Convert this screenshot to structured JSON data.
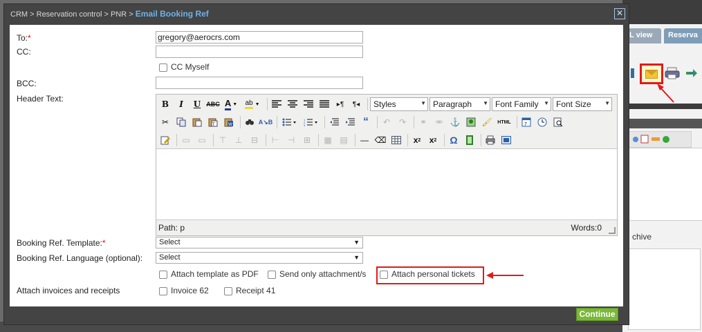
{
  "background": {
    "tabs": [
      "L view",
      "Reserva"
    ],
    "archive_label": "chive"
  },
  "modal": {
    "breadcrumb": [
      "CRM",
      "Reservation control",
      "PNR"
    ],
    "breadcrumb_sep": ">",
    "title": "Email Booking Ref"
  },
  "form": {
    "to_label": "To:",
    "to_value": "gregory@aerocrs.com",
    "cc_label": "CC:",
    "cc_value": "",
    "cc_myself_label": "CC Myself",
    "bcc_label": "BCC:",
    "bcc_value": "",
    "header_text_label": "Header Text:",
    "required_mark": "*",
    "booking_template_label": "Booking Ref. Template:",
    "booking_template_value": "Select",
    "booking_language_label": "Booking Ref. Language (optional):",
    "booking_language_value": "Select",
    "attach_pdf_label": "Attach template as PDF",
    "send_only_attachments_label": "Send only attachment/s",
    "attach_personal_tickets_label": "Attach personal tickets",
    "attach_invoices_label": "Attach invoices and receipts",
    "invoice_label": "Invoice 62",
    "receipt_label": "Receipt 41"
  },
  "editor": {
    "styles_value": "Styles",
    "paragraph_value": "Paragraph",
    "font_family_value": "Font Family",
    "font_size_value": "Font Size",
    "path_label": "Path: p",
    "words_label": "Words:0",
    "html_button": "HTML"
  },
  "actions": {
    "continue_label": "Continue"
  },
  "colors": {
    "highlight": "#e01a1a",
    "breadcrumb_current": "#6fb2e8",
    "continue_bg": "#7ab83a"
  }
}
